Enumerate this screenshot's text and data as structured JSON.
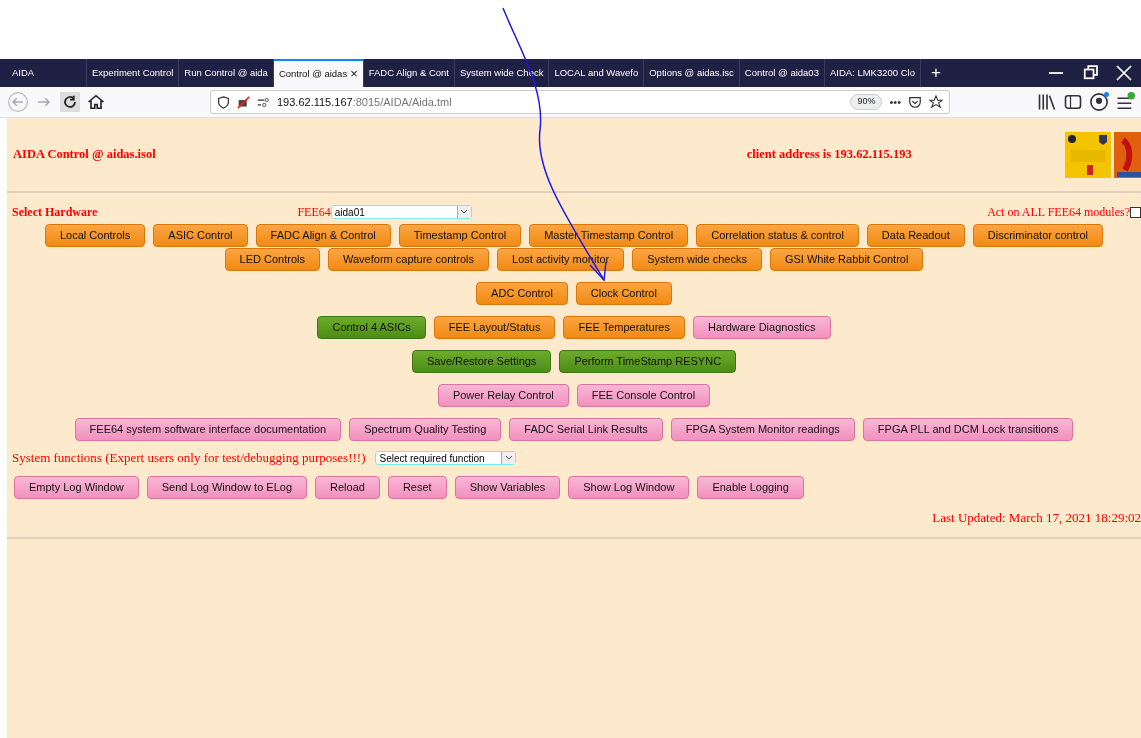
{
  "browser": {
    "tabs": [
      {
        "label": "AIDA",
        "selected": false
      },
      {
        "label": "Experiment Control",
        "selected": false
      },
      {
        "label": "Run Control @ aida",
        "selected": false
      },
      {
        "label": "Control @ aidas",
        "selected": true
      },
      {
        "label": "FADC Align & Cont",
        "selected": false
      },
      {
        "label": "System wide Check",
        "selected": false
      },
      {
        "label": "LOCAL and Wavefo",
        "selected": false
      },
      {
        "label": "Options @ aidas.isc",
        "selected": false
      },
      {
        "label": "Control @ aida03",
        "selected": false
      },
      {
        "label": "AIDA: LMK3200 Clo",
        "selected": false
      }
    ],
    "tab_close": "×",
    "new_tab": "+",
    "url": {
      "host": "193.62.115.167",
      "path": ":8015/AIDA/Aida.tml"
    },
    "zoom": "90%",
    "more": "•••"
  },
  "page": {
    "title": "AIDA Control @ aidas.isol",
    "client_address": "client address is 193.62.115.193",
    "select_hardware": "Select Hardware",
    "fee64_label": "FEE64",
    "fee64_value": "aida01",
    "act_all": {
      "label": "Act on ALL FEE64 modules?",
      "checked": false
    },
    "button_rows": [
      [
        {
          "label": "Local Controls",
          "kind": "orange"
        },
        {
          "label": "ASIC Control",
          "kind": "orange"
        },
        {
          "label": "FADC Align & Control",
          "kind": "orange"
        },
        {
          "label": "Timestamp Control",
          "kind": "orange"
        },
        {
          "label": "Master Timestamp Control",
          "kind": "orange"
        },
        {
          "label": "Correlation status & control",
          "kind": "orange"
        },
        {
          "label": "Data Readout",
          "kind": "orange"
        },
        {
          "label": "Discriminator control",
          "kind": "orange"
        }
      ],
      [
        {
          "label": "LED Controls",
          "kind": "orange"
        },
        {
          "label": "Waveform capture controls",
          "kind": "orange"
        },
        {
          "label": "Lost activity monitor",
          "kind": "orange"
        },
        {
          "label": "System wide checks",
          "kind": "orange"
        },
        {
          "label": "GSI White Rabbit Control",
          "kind": "orange"
        }
      ],
      [
        {
          "label": "ADC Control",
          "kind": "orange"
        },
        {
          "label": "Clock Control",
          "kind": "orange"
        }
      ],
      [
        {
          "label": "Control 4 ASICs",
          "kind": "green"
        },
        {
          "label": "FEE Layout/Status",
          "kind": "orange"
        },
        {
          "label": "FEE Temperatures",
          "kind": "orange"
        },
        {
          "label": "Hardware Diagnostics",
          "kind": "pink"
        }
      ],
      [
        {
          "label": "Save/Restore Settings",
          "kind": "green"
        },
        {
          "label": "Perform TimeStamp RESYNC",
          "kind": "green"
        }
      ],
      [
        {
          "label": "Power Relay Control",
          "kind": "pink"
        },
        {
          "label": "FEE Console Control",
          "kind": "pink"
        }
      ],
      [
        {
          "label": "FEE64 system software interface documentation",
          "kind": "pink"
        },
        {
          "label": "Spectrum Quality Testing",
          "kind": "pink"
        },
        {
          "label": "FADC Serial Link Results",
          "kind": "pink"
        },
        {
          "label": "FPGA System Monitor readings",
          "kind": "pink"
        },
        {
          "label": "FPGA PLL and DCM Lock transitions",
          "kind": "pink"
        }
      ]
    ],
    "system_functions": "System functions (Expert users only for test/debugging purposes!!!)",
    "function_select": "Select required function",
    "log_buttons": [
      {
        "label": "Empty Log Window",
        "kind": "pink"
      },
      {
        "label": "Send Log Window to ELog",
        "kind": "pink"
      },
      {
        "label": "Reload",
        "kind": "pink"
      },
      {
        "label": "Reset",
        "kind": "pink"
      },
      {
        "label": "Show Variables",
        "kind": "pink"
      },
      {
        "label": "Show Log Window",
        "kind": "pink"
      },
      {
        "label": "Enable Logging",
        "kind": "pink"
      }
    ],
    "last_updated": "Last Updated: March 17, 2021 18:29:02"
  }
}
